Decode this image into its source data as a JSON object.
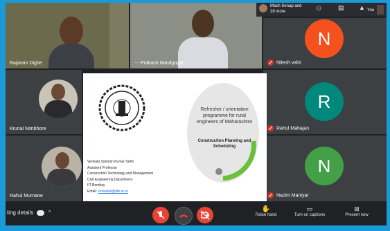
{
  "top_bar": {
    "participants_label": "Mach Senap and 28 more",
    "you_label": "You"
  },
  "participants": [
    {
      "name": "Rajaram Dighe"
    },
    {
      "name": "Prakash Nandgopal"
    },
    {
      "name": "Nitesh valvi",
      "initial": "N",
      "color": "#f4511e"
    },
    {
      "name": "Krunal Nimbhore"
    },
    {
      "name": "Rahul Mahajan",
      "initial": "R",
      "color": "#00897b"
    },
    {
      "name": "Rahul Murnane"
    },
    {
      "name": "Nazim Maniyar",
      "initial": "N",
      "color": "#43a047"
    }
  ],
  "slide": {
    "title_line1": "Refresher / orientation",
    "title_line2": "programme for rural",
    "title_line3": "engineers of Maharashtra",
    "subtitle_line1": "Construction Planning and",
    "subtitle_line2": "Scheduling",
    "presenter_name": "Venkata Santosh Kumar Delhi",
    "role": "Assistent Professor",
    "dept1": "Construction Technology and Management",
    "dept2": "Civil Engineering Department",
    "institute": "IIT Bombay",
    "email_label": "Email:",
    "email": "venkatad@iitb.ac.in"
  },
  "bottom_bar": {
    "meeting_details": "ting details",
    "raise_hand": "Raise hand",
    "captions": "Turn on captions",
    "present": "Present now"
  },
  "colors": {
    "accent_frame": "#1a9ad6",
    "end_call": "#ea4335"
  }
}
